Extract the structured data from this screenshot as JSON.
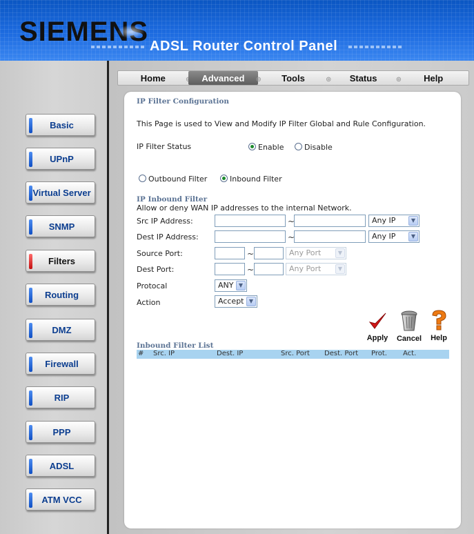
{
  "header": {
    "brand": "SIEMENS",
    "title": "ADSL Router Control Panel",
    "colors": {
      "header_blue": "#1d6be0",
      "nav_text": "#0b3d8f"
    }
  },
  "sidebar": {
    "items": [
      {
        "label": "Basic"
      },
      {
        "label": "UPnP"
      },
      {
        "label": "Virtual Server"
      },
      {
        "label": "SNMP"
      },
      {
        "label": "Filters",
        "active": true
      },
      {
        "label": "Routing"
      },
      {
        "label": "DMZ"
      },
      {
        "label": "Firewall"
      },
      {
        "label": "RIP"
      },
      {
        "label": "PPP"
      },
      {
        "label": "ADSL"
      },
      {
        "label": "ATM VCC"
      }
    ]
  },
  "tabs": [
    {
      "label": "Home"
    },
    {
      "label": "Advanced",
      "active": true
    },
    {
      "label": "Tools"
    },
    {
      "label": "Status"
    },
    {
      "label": "Help"
    }
  ],
  "page": {
    "heading": "IP Filter Configuration",
    "description": "This Page is used to View and Modify IP Filter Global and Rule Configuration.",
    "status_label": "IP Filter Status",
    "enable_label": "Enable",
    "disable_label": "Disable",
    "status_value": "Enable",
    "outbound_label": "Outbound Filter",
    "inbound_label": "Inbound Filter",
    "direction_value": "Inbound Filter",
    "inbound_heading": "IP Inbound Filter",
    "inbound_desc": "Allow or deny WAN IP addresses to the internal Network.",
    "src_ip_label": "Src IP Address:",
    "dest_ip_label": "Dest IP Address:",
    "source_port_label": "Source Port:",
    "dest_port_label": "Dest Port:",
    "protocol_label": "Protocal",
    "action_label": "Action",
    "src_ip_select": "Any IP",
    "dest_ip_select": "Any IP",
    "source_port_select": "Any Port",
    "dest_port_select": "Any Port",
    "protocol_select": "ANY",
    "action_select": "Accept",
    "tilde": "~",
    "apply": "Apply",
    "cancel": "Cancel",
    "help": "Help",
    "list_heading": "Inbound Filter List",
    "list_columns": [
      "#",
      "Src. IP",
      "Dest. IP",
      "Src. Port",
      "Dest. Port",
      "Prot.",
      "Act."
    ]
  }
}
